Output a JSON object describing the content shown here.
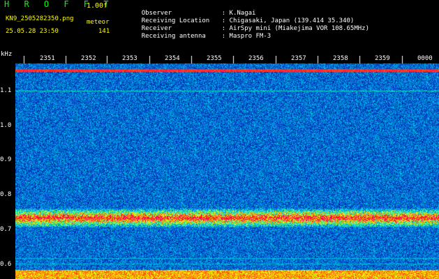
{
  "header": {
    "app_title": "H R O F F T",
    "version": "1.00f",
    "filename": "KN9_2505282350.png",
    "mode": "meteor",
    "datetime": "25.05.28 23:50",
    "count": "141"
  },
  "meta": [
    {
      "key": "Observer",
      "value": ": K.Nagai"
    },
    {
      "key": "Receiving Location",
      "value": ": Chigasaki, Japan (139.414 35.340)"
    },
    {
      "key": "Receiver",
      "value": ": AirSpy mini (Miakejima VOR 108.65MHz)"
    },
    {
      "key": "Receiving antenna",
      "value": ": Maspro FM-3"
    }
  ],
  "axis": {
    "unit": "kHz",
    "freq_ticks": [
      "1.1",
      "1.0",
      "0.9",
      "0.8",
      "0.7",
      "0.6"
    ],
    "time_labels": [
      "2351",
      "2352",
      "2353",
      "2354",
      "2355",
      "2356",
      "2357",
      "2358",
      "2359",
      "0000"
    ]
  },
  "colors": {
    "bg": "#000000",
    "title": "#00ff00",
    "info": "#ffff00",
    "text": "#ffffff"
  }
}
